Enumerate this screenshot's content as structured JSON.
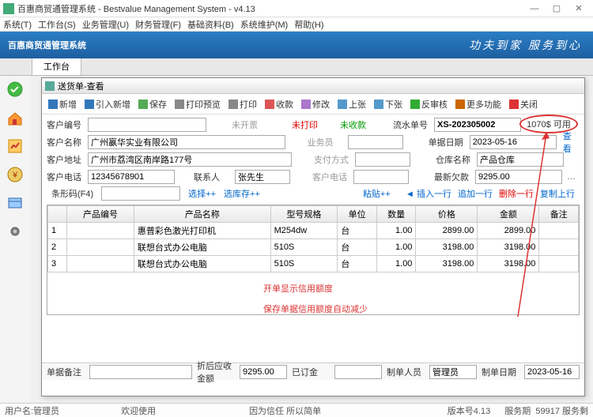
{
  "window": {
    "title": "百惠商贸通管理系统 - Bestvalue Management System - v4.13"
  },
  "menu": [
    "系统(T)",
    "工作台(S)",
    "业务管理(U)",
    "财务管理(F)",
    "基础资料(B)",
    "系统维护(M)",
    "帮助(H)"
  ],
  "banner": {
    "title": "百惠商贸通管理系统",
    "slogan": "功夫到家 服务到心"
  },
  "tabs": [
    {
      "label": "工作台"
    }
  ],
  "dialog": {
    "title": "送货单-查看"
  },
  "toolbar": [
    {
      "label": "新增",
      "icon": "#37b"
    },
    {
      "label": "引入新增",
      "icon": "#37b"
    },
    {
      "label": "保存",
      "icon": "#5a5"
    },
    {
      "label": "打印预览",
      "icon": "#888"
    },
    {
      "label": "打印",
      "icon": "#888"
    },
    {
      "label": "收款",
      "icon": "#d55"
    },
    {
      "label": "修改",
      "icon": "#a7c"
    },
    {
      "label": "上张",
      "icon": "#59c"
    },
    {
      "label": "下张",
      "icon": "#59c"
    },
    {
      "label": "反审核",
      "icon": "#3a3"
    },
    {
      "label": "更多功能",
      "icon": "#c60"
    },
    {
      "label": "关闭",
      "icon": "#d33"
    }
  ],
  "form": {
    "cust_no_lbl": "客户编号",
    "cust_no": "",
    "not_invoiced": "未开票",
    "not_printed": "未打印",
    "not_received": "未收款",
    "flow_no_lbl": "流水单号",
    "flow_no": "XS-202305002",
    "credit": "1070$ 可用",
    "view": "查看",
    "cust_name_lbl": "客户名称",
    "cust_name": "广州嬴华实业有限公司",
    "sales_lbl": "业务员",
    "sales": "",
    "bill_date_lbl": "单据日期",
    "bill_date": "2023-05-16",
    "addr_lbl": "客户地址",
    "addr": "广州市荔湾区南岸路177号",
    "pay_lbl": "支付方式",
    "pay": "",
    "wh_lbl": "仓库名称",
    "wh": "产品仓库",
    "tel_lbl": "客户电话",
    "tel": "12345678901",
    "contact_lbl": "联系人",
    "contact": "张先生",
    "cust_tel_lbl": "客户电话",
    "cust_tel": "",
    "last_owe_lbl": "最新欠款",
    "last_owe": "9295.00"
  },
  "row5": {
    "barcode_lbl": "条形码(F4)",
    "barcode": "",
    "select": "选择++",
    "selectstock": "选库存++",
    "paste": "粘贴++",
    "insert": "◄ 插入一行",
    "append": "追加一行",
    "delete": "删除一行",
    "copy": "复制上行"
  },
  "grid": {
    "headers": [
      "",
      "产品编号",
      "产品名称",
      "型号规格",
      "单位",
      "数量",
      "价格",
      "金额",
      "备注"
    ],
    "rows": [
      {
        "n": "1",
        "name": "惠普彩色激光打印机",
        "spec": "M254dw",
        "unit": "台",
        "qty": "1.00",
        "price": "2899.00",
        "amt": "2899.00"
      },
      {
        "n": "2",
        "name": "联想台式办公电脑",
        "spec": "510S",
        "unit": "台",
        "qty": "1.00",
        "price": "3198.00",
        "amt": "3198.00"
      },
      {
        "n": "3",
        "name": "联想台式办公电脑",
        "spec": "510S",
        "unit": "台",
        "qty": "1.00",
        "price": "3198.00",
        "amt": "3198.00"
      }
    ]
  },
  "annot": {
    "l1": "开单显示信用额度",
    "l2": "保存单据信用额度自动减少"
  },
  "footer": {
    "remark_lbl": "单据备注",
    "remark": "",
    "disc_lbl": "折后应收金额",
    "disc": "9295.00",
    "deposit_lbl": "已订金",
    "deposit": "",
    "maker_lbl": "制单人员",
    "maker": "管理员",
    "mkdate_lbl": "制单日期",
    "mkdate": "2023-05-16"
  },
  "status": {
    "user_lbl": "用户名:",
    "user": "管理员",
    "welcome": "欢迎使用",
    "motto": "因为信任 所以简单",
    "ver_lbl": "版本号",
    "ver": "4.13",
    "svc_lbl": "服务期",
    "svc": "59917 服务剩"
  }
}
